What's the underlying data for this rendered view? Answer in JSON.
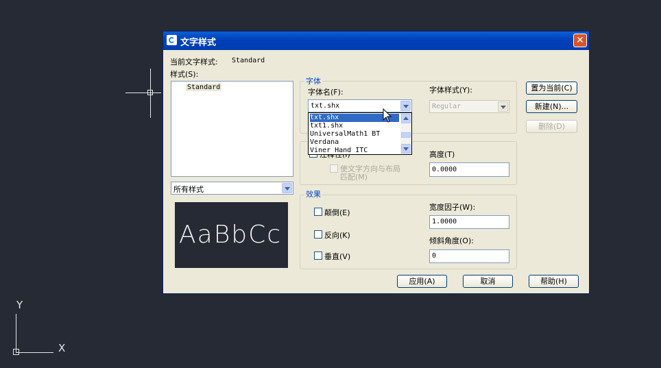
{
  "ucs": {
    "y_label": "Y",
    "x_label": "X"
  },
  "dialog": {
    "title": "文字样式",
    "current_style_label": "当前文字样式:",
    "current_style_value": "Standard",
    "styles_label": "样式(S):",
    "styles_list": [
      "Standard"
    ],
    "styles_filter": "所有样式",
    "preview_text": "AaBbCc",
    "font_group": {
      "title": "字体",
      "font_name_label": "字体名(F):",
      "font_name_value": "txt.shx",
      "font_style_label": "字体样式(Y):",
      "font_style_value": "Regular",
      "dropdown_options": [
        "txt.shx",
        "txt1.shx",
        "UniversalMath1 BT",
        "Verdana",
        "Viner Hand ITC"
      ],
      "dropdown_selected_index": 0
    },
    "size_group": {
      "annotative_label": "注释性(I)",
      "match_orientation_line1": "使文字方向与布局",
      "match_orientation_line2": "匹配(M)",
      "height_label": "高度(T)",
      "height_value": "0.0000"
    },
    "effects_group": {
      "title": "效果",
      "upside_down_label": "颠倒(E)",
      "backwards_label": "反向(K)",
      "vertical_label": "垂直(V)",
      "width_factor_label": "宽度因子(W):",
      "width_factor_value": "1.0000",
      "oblique_label": "倾斜角度(O):",
      "oblique_value": "0"
    },
    "buttons": {
      "set_current": "置为当前(C)",
      "new": "新建(N)...",
      "delete": "删除(D)",
      "apply": "应用(A)",
      "cancel": "取消",
      "help": "帮助(H)"
    }
  }
}
